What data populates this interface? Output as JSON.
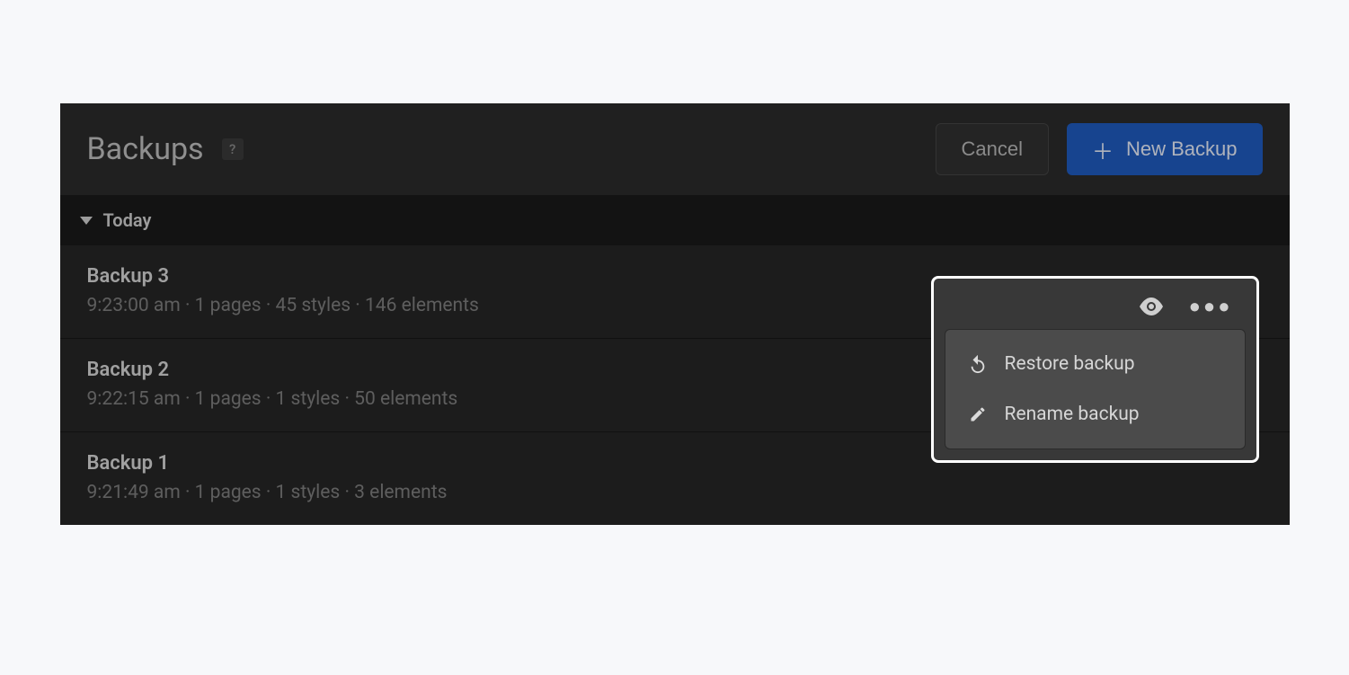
{
  "header": {
    "title": "Backups",
    "cancel_label": "Cancel",
    "new_backup_label": "New Backup",
    "help_label": "?"
  },
  "group": {
    "label": "Today"
  },
  "backups": [
    {
      "title": "Backup 3",
      "meta": "9:23:00 am · 1 pages · 45 styles · 146 elements"
    },
    {
      "title": "Backup 2",
      "meta": "9:22:15 am · 1 pages · 1 styles · 50 elements"
    },
    {
      "title": "Backup 1",
      "meta": "9:21:49 am · 1 pages · 1 styles · 3 elements"
    }
  ],
  "context_menu": {
    "restore_label": "Restore backup",
    "rename_label": "Rename backup"
  }
}
